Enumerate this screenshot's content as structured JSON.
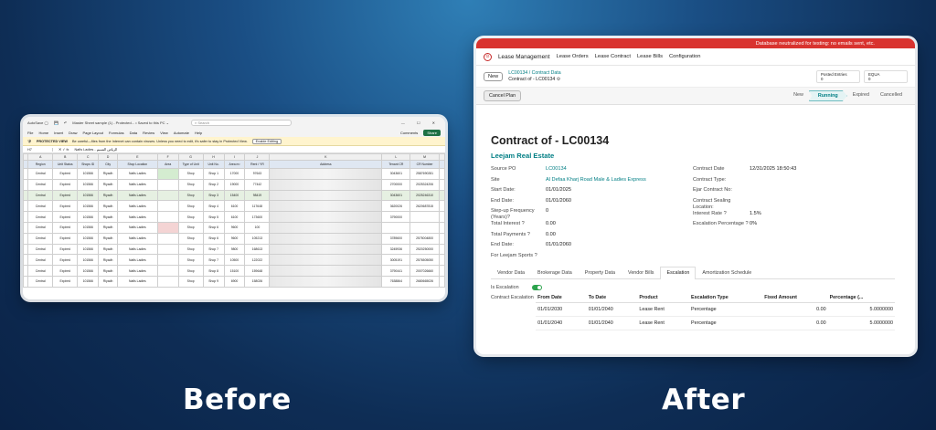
{
  "captions": {
    "before": "Before",
    "after": "After"
  },
  "excel": {
    "filename": "Master Sheet sample (1) - Protected... • Saved to this PC ⌄",
    "search_placeholder": "Search",
    "menu": [
      "File",
      "Home",
      "Insert",
      "Draw",
      "Page Layout",
      "Formulas",
      "Data",
      "Review",
      "View",
      "Automate",
      "Help"
    ],
    "comments": "Comments",
    "share": "Share",
    "protected_view": "PROTECTED VIEW",
    "protected_msg": "Be careful—files from the Internet can contain viruses. Unless you need to edit, it's safer to stay in Protected View.",
    "enable_editing": "Enable Editing",
    "cell_ref": "H7",
    "formula": "Nafis Ladies - الرياض النسيم",
    "col_letters": [
      "A",
      "B",
      "C",
      "D",
      "E",
      "F",
      "G",
      "H",
      "I",
      "J",
      "K",
      "L",
      "M"
    ],
    "headers": [
      "Region",
      "Unit Status",
      "Shops ID",
      "City",
      "Shop Location",
      "Area",
      "Type of Unit",
      "Unit No.",
      "Area m²",
      "Rent / YR",
      "Address",
      "Tenant CR",
      "CR Number"
    ],
    "rows": [
      [
        "Central",
        "Expired",
        "101566",
        "Riyadh",
        "Nafis Ladies",
        "green",
        "Shop",
        "Shop 1",
        "17000",
        "97643",
        "",
        "3043601",
        "2587690281"
      ],
      [
        "Central",
        "Expired",
        "101566",
        "Riyadh",
        "Nafis Ladies",
        "",
        "Shop",
        "Shop 2",
        "19000",
        "77442",
        "",
        "2700000",
        "2025324206"
      ],
      [
        "Central",
        "Expired",
        "101566",
        "Riyadh",
        "Nafis Ladies",
        "green",
        "Shop",
        "Shop 3",
        "15400",
        "98419",
        "",
        "3043601",
        "2025246310"
      ],
      [
        "Central",
        "Expired",
        "101566",
        "Riyadh",
        "Nafis Ladies",
        "",
        "Shop",
        "Shop 4",
        "6100",
        "117648",
        "",
        "3620026",
        "2620687815"
      ],
      [
        "Central",
        "Expired",
        "101566",
        "Riyadh",
        "Nafis Ladies",
        "",
        "Shop",
        "Shop 5",
        "6100",
        "173600",
        "",
        "3790000",
        ""
      ],
      [
        "Central",
        "Expired",
        "101566",
        "Riyadh",
        "Nafis Ladies",
        "red",
        "Shop",
        "Shop 6",
        "9600",
        "100",
        "",
        "",
        ""
      ],
      [
        "Central",
        "Expired",
        "101566",
        "Riyadh",
        "Nafis Ladies",
        "",
        "Shop",
        "Shop 6",
        "9600",
        "105213",
        "",
        "3789600",
        "2575004800"
      ],
      [
        "Central",
        "Expired",
        "101566",
        "Riyadh",
        "Nafis Ladies",
        "",
        "Shop",
        "Shop 7",
        "9800",
        "168613",
        "",
        "3245936",
        "2520250000"
      ],
      [
        "Central",
        "Expired",
        "101566",
        "Riyadh",
        "Nafis Ladies",
        "",
        "Shop",
        "Shop 7",
        "10500",
        "122022",
        "",
        "3005191",
        "2576505050"
      ],
      [
        "Central",
        "Expired",
        "101566",
        "Riyadh",
        "Nafis Ladies",
        "",
        "Shop",
        "Shop 8",
        "15100",
        "159648",
        "",
        "3790441",
        "2007026660"
      ],
      [
        "Central",
        "Expired",
        "101566",
        "Riyadh",
        "Nafis Ladies",
        "",
        "Shop",
        "Shop 9",
        "6900",
        "158026",
        "",
        "7638864",
        "2680665026"
      ]
    ]
  },
  "odoo": {
    "banner": "Database neutralized for testing: no emails sent, etc.",
    "app_name": "Lease Management",
    "menu": [
      "Lease Orders",
      "Lease Contract",
      "Lease Bills",
      "Configuration"
    ],
    "new_button": "New",
    "breadcrumb_link": "LC00134 / Contract Data",
    "breadcrumb_current": "Contract of - LC00134",
    "stat_posted_label": "Posted Entries",
    "stat_posted_value": "0",
    "stat_equa_label": "EQUA",
    "stat_equa_value": "0",
    "cancel_plan": "Cancel Plan",
    "stages": [
      "New",
      "Running",
      "Expired",
      "Cancelled"
    ],
    "active_stage": "Running",
    "title": "Contract of - LC00134",
    "subtitle": "Leejam Real Estate",
    "left_fields": [
      {
        "label": "Source PO",
        "value": "LC00134",
        "link": true
      },
      {
        "label": "Site",
        "value": "Al Defaa Kharj Road Male & Ladies Express",
        "link": true
      },
      {
        "label": "Start Date:",
        "value": "01/01/2025"
      },
      {
        "label": "End Date:",
        "value": "01/01/2060"
      },
      {
        "label": "Step-up Frequency (Years)?",
        "value": "0"
      },
      {
        "label": "Total Interest ?",
        "value": "0.00"
      },
      {
        "label": "Total Payments ?",
        "value": "0.00"
      },
      {
        "label": "End Date:",
        "value": "01/01/2060"
      },
      {
        "label": "For Leejam Sports ?",
        "value": ""
      }
    ],
    "right_fields": [
      {
        "label": "Contract Date",
        "value": "12/31/2025 18:50:43"
      },
      {
        "label": "Contract Type:",
        "value": ""
      },
      {
        "label": "Ejar Contract No:",
        "value": ""
      },
      {
        "label": "Contract Sealing Location:",
        "value": ""
      },
      {
        "label": "Interest Rate ?",
        "value": "1.5%"
      },
      {
        "label": "Escalation Percentage ?",
        "value": "0%"
      }
    ],
    "tabs": [
      "Vendor Data",
      "Brokerage Data",
      "Property Data",
      "Vendor Bills",
      "Escalation",
      "Amortization Schedule"
    ],
    "active_tab": "Escalation",
    "is_escalation_label": "Is Escalation",
    "contract_escalation_label": "Contract Escalation",
    "esc_headers": [
      "From Date",
      "To Date",
      "Product",
      "Escalation Type",
      "Fixed Amount",
      "Percentage (..."
    ],
    "esc_rows": [
      [
        "01/01/2030",
        "01/01/2040",
        "Lease Rent",
        "Percentage",
        "0.00",
        "5.0000000"
      ],
      [
        "01/01/2040",
        "01/01/2040",
        "Lease Rent",
        "Percentage",
        "0.00",
        "5.0000000"
      ]
    ]
  }
}
